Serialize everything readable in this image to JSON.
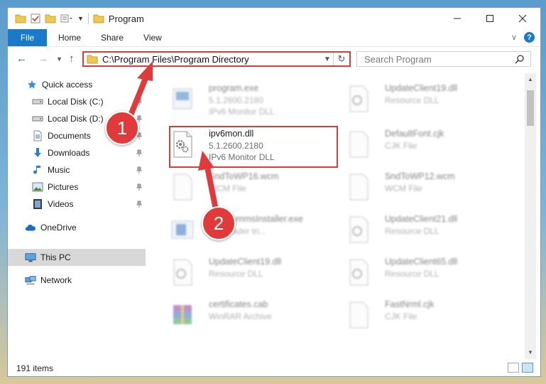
{
  "window": {
    "title": "Program",
    "tabs": [
      {
        "label": "File",
        "active": true
      },
      {
        "label": "Home"
      },
      {
        "label": "Share"
      },
      {
        "label": "View"
      }
    ],
    "minimize_icon": "minimize-icon",
    "maximize_icon": "maximize-icon",
    "close_icon": "close-icon",
    "help_glyph": "?"
  },
  "address": {
    "path": "C:\\Program Files\\Program Directory"
  },
  "search": {
    "placeholder": "Search Program"
  },
  "sidebar": {
    "items": [
      {
        "label": "Quick access",
        "icon": "star-icon",
        "pinned": false
      },
      {
        "label": "Local Disk (C:)",
        "icon": "drive-icon",
        "pinned": true
      },
      {
        "label": "Local Disk (D:)",
        "icon": "drive-icon",
        "pinned": true
      },
      {
        "label": "Documents",
        "icon": "documents-icon",
        "pinned": true
      },
      {
        "label": "Downloads",
        "icon": "download-icon",
        "pinned": true
      },
      {
        "label": "Music",
        "icon": "music-icon",
        "pinned": true
      },
      {
        "label": "Pictures",
        "icon": "pictures-icon",
        "pinned": true
      },
      {
        "label": "Videos",
        "icon": "video-icon",
        "pinned": true
      },
      {
        "label": "OneDrive",
        "icon": "cloud-icon",
        "pinned": false
      },
      {
        "label": "This PC",
        "icon": "computer-icon",
        "pinned": false,
        "selected": true
      },
      {
        "label": "Network",
        "icon": "network-icon",
        "pinned": false
      }
    ]
  },
  "files": [
    {
      "name": "program.exe",
      "version": "5.1.2600.2180",
      "type": "IPv6 Monitor DLL",
      "icon": "exe-icon"
    },
    {
      "name": "UpdateClient19.dll",
      "version": "",
      "type": "Resource DLL",
      "icon": "dll-icon"
    },
    {
      "name": "ipv6mon.dll",
      "version": "5.1.2600.2180",
      "type": "IPv6 Monitor DLL",
      "icon": "dll-gear-icon",
      "highlighted": true
    },
    {
      "name": "DefaultFont.cjk",
      "version": "",
      "type": "CJK File",
      "icon": "blank-file-icon"
    },
    {
      "name": "SndToWP16.wcm",
      "version": "",
      "type": "WCM File",
      "icon": "blank-file-icon"
    },
    {
      "name": "SndToWP12.wcm",
      "version": "",
      "type": "WCM File",
      "icon": "blank-file-icon"
    },
    {
      "name": "TeleCommsInstaller.exe",
      "version": "",
      "type": "Onereader tri...",
      "icon": "installer-icon"
    },
    {
      "name": "UpdateClient21.dll",
      "version": "",
      "type": "Resource DLL",
      "icon": "dll-icon"
    },
    {
      "name": "UpdateClient19.dll",
      "version": "",
      "type": "Resource DLL",
      "icon": "dll-icon"
    },
    {
      "name": "UpdateClient65.dll",
      "version": "",
      "type": "Resource DLL",
      "icon": "dll-icon"
    },
    {
      "name": "certificates.cab",
      "version": "",
      "type": "WinRAR Archive",
      "icon": "archive-icon"
    },
    {
      "name": "FastNrml.cjk",
      "version": "",
      "type": "CJK File",
      "icon": "blank-file-icon"
    }
  ],
  "status": {
    "item_count": "191 items"
  },
  "callouts": [
    {
      "number": "1"
    },
    {
      "number": "2"
    }
  ],
  "colors": {
    "accent": "#1979ca",
    "highlight_red": "#e03a3a"
  }
}
